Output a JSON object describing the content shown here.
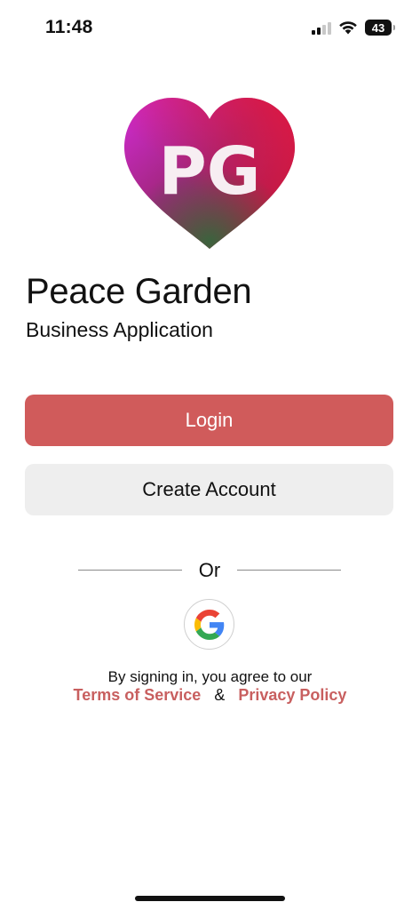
{
  "status_bar": {
    "time": "11:48",
    "battery": "43"
  },
  "logo": {
    "letters": "PG"
  },
  "header": {
    "title": "Peace Garden",
    "subtitle": "Business Application"
  },
  "actions": {
    "login_label": "Login",
    "create_account_label": "Create Account",
    "divider_text": "Or"
  },
  "legal": {
    "prefix": "By signing in, you agree to our",
    "terms_label": "Terms of Service",
    "separator": "&",
    "privacy_label": "Privacy Policy"
  },
  "colors": {
    "primary": "#d05b5b",
    "secondary_button": "#eeeeee",
    "link": "#c85f5f"
  },
  "icons": {
    "google": "google-icon",
    "signal": "cellular-signal-icon",
    "wifi": "wifi-icon",
    "battery": "battery-icon"
  }
}
